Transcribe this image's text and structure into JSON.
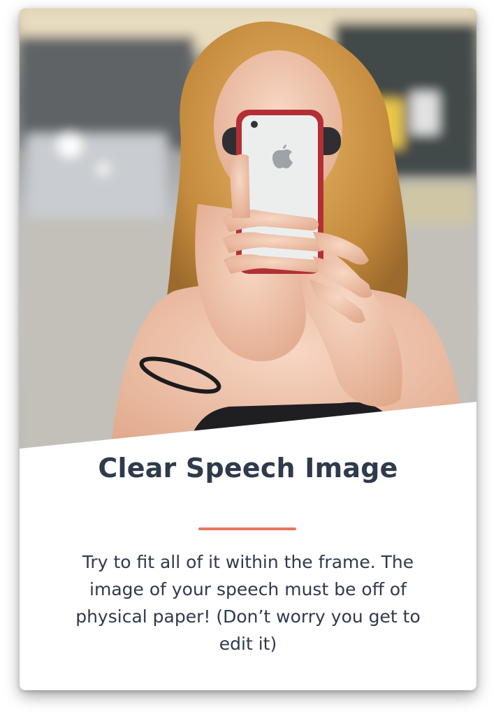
{
  "card": {
    "title": "Clear Speech Image",
    "body_text": "Try to fit all of it within the frame. The image of your speech must be off of physical paper! (Don’t worry you get to edit it)",
    "accent_color": "#e9765d",
    "photo_icon": "woman-holding-phone-photo",
    "phone_logo_icon": "apple-logo-icon"
  }
}
